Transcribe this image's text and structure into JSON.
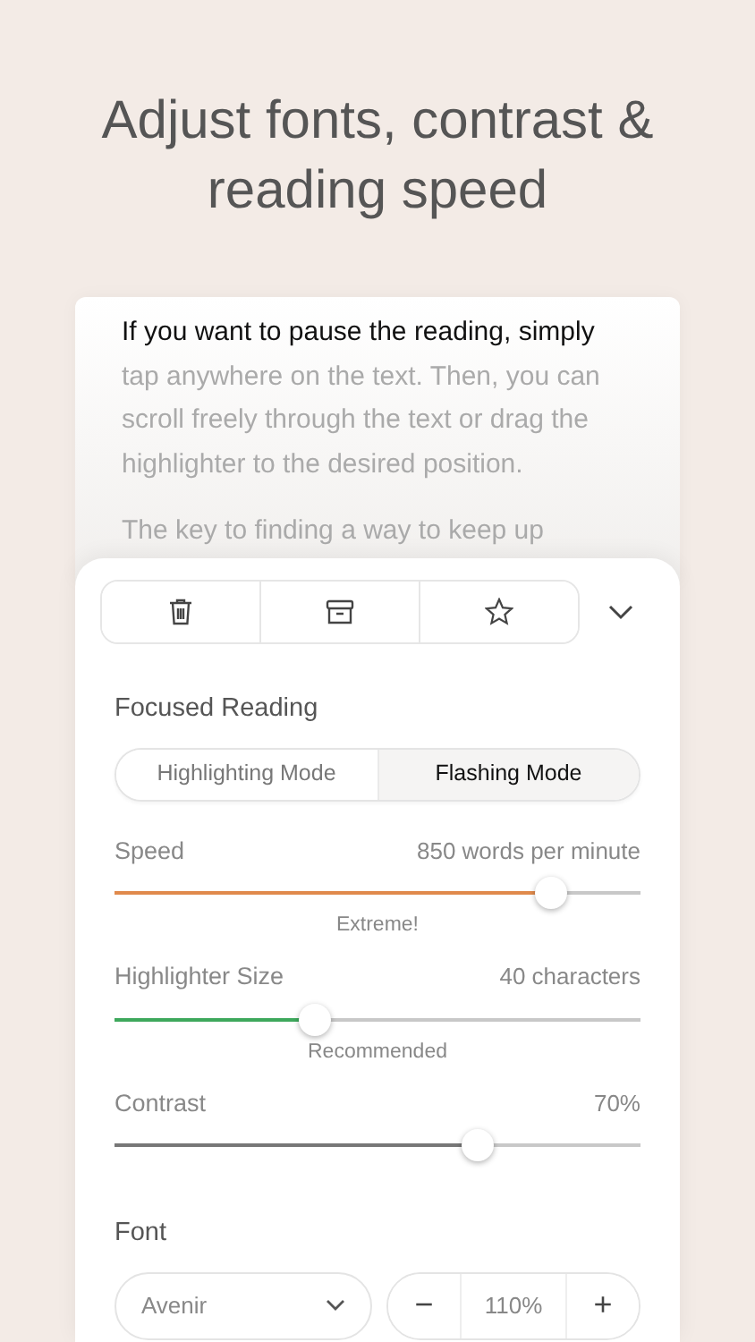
{
  "headline": "Adjust fonts, contrast & reading speed",
  "reading_text": [
    {
      "segments": [
        {
          "text": "If you want to pause the reading, simply",
          "highlighted": true
        },
        {
          "text": " tap anywhere on the text. Then, you can scroll freely through the text or drag the highlighter to the desired position.",
          "highlighted": false
        }
      ]
    },
    {
      "segments": [
        {
          "text": "The key to finding a way to keep up",
          "highlighted": false
        }
      ]
    }
  ],
  "toolbar": [
    {
      "kind": "trash"
    },
    {
      "kind": "archive"
    },
    {
      "kind": "star"
    }
  ],
  "collapse": {
    "kind": "chevron"
  },
  "focused_reading": {
    "title": "Focused Reading",
    "modes": [
      {
        "label": "Highlighting Mode",
        "selected": false
      },
      {
        "label": "Flashing Mode",
        "selected": true
      }
    ]
  },
  "sliders": [
    {
      "name": "Speed",
      "reading": "850 words per minute",
      "level": 0.83,
      "color": "#e08a4c",
      "hint": "Extreme!"
    },
    {
      "name": "Highlighter Size",
      "reading": "40 characters",
      "level": 0.38,
      "color": "#3ea85c",
      "hint": "Recommended"
    },
    {
      "name": "Contrast",
      "reading": "70%",
      "level": 0.69,
      "color": "#777777"
    }
  ],
  "font": {
    "title": "Font",
    "family": "Avenir",
    "minus": "−",
    "size": "110%",
    "plus": "+"
  }
}
